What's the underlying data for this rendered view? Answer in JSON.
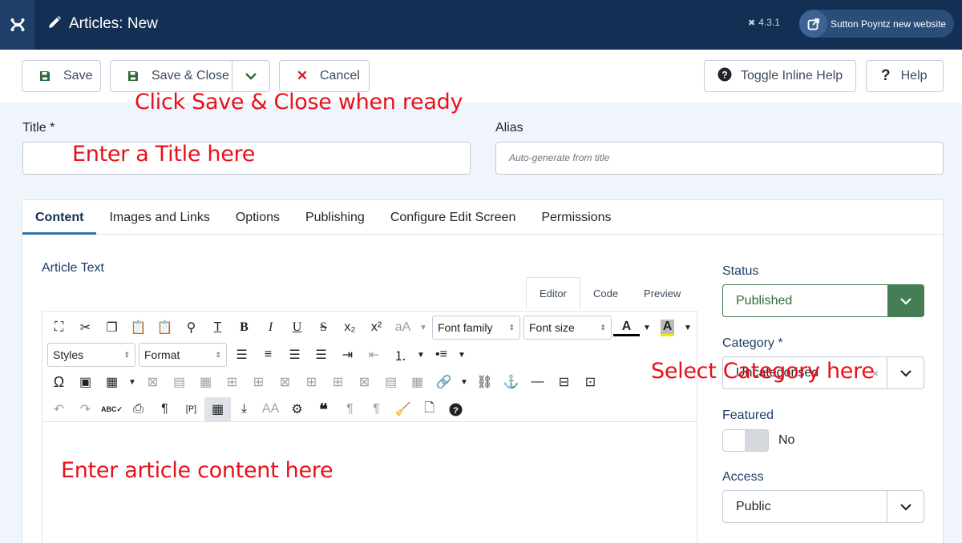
{
  "header": {
    "title": "Articles: New",
    "version": "4.3.1",
    "site_button": "Sutton Poyntz new website"
  },
  "toolbar": {
    "save": "Save",
    "save_close": "Save & Close",
    "cancel": "Cancel",
    "toggle_help": "Toggle Inline Help",
    "help": "Help"
  },
  "annotations": {
    "save_close_hint": "Click Save & Close when ready",
    "title_hint": "Enter a Title here",
    "category_hint": "Select Category here",
    "content_hint": "Enter article content here"
  },
  "form": {
    "title_label": "Title *",
    "alias_label": "Alias",
    "alias_placeholder": "Auto-generate from title"
  },
  "tabs": [
    "Content",
    "Images and Links",
    "Options",
    "Publishing",
    "Configure Edit Screen",
    "Permissions"
  ],
  "editor": {
    "label": "Article Text",
    "tabs": [
      "Editor",
      "Code",
      "Preview"
    ],
    "font_family": "Font family",
    "font_size": "Font size",
    "styles": "Styles",
    "format": "Format"
  },
  "sidebar": {
    "status_label": "Status",
    "status_value": "Published",
    "category_label": "Category *",
    "category_value": "Uncategorised",
    "featured_label": "Featured",
    "featured_value": "No",
    "access_label": "Access",
    "access_value": "Public"
  },
  "colors": {
    "header_bg": "#132f53",
    "status_green": "#457d54",
    "annotation_red": "#e8101a"
  }
}
